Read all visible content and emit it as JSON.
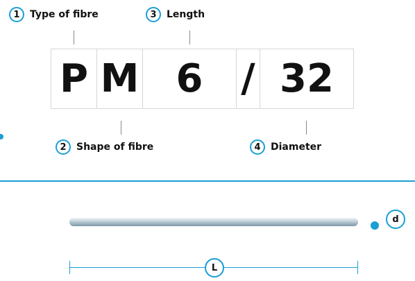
{
  "callouts": [
    {
      "number": "1",
      "label": "Type of fibre"
    },
    {
      "number": "2",
      "label": "Shape of fibre"
    },
    {
      "number": "3",
      "label": "Length"
    },
    {
      "number": "4",
      "label": "Diameter"
    }
  ],
  "code": {
    "type": "P",
    "shape": "M",
    "length": "6",
    "separator": "/",
    "diameter": "32"
  },
  "fibre": {
    "diameter_symbol": "d",
    "length_symbol": "L"
  },
  "colors": {
    "accent": "#1a9fd4",
    "text": "#111111",
    "box_border": "#d6d6d6"
  }
}
